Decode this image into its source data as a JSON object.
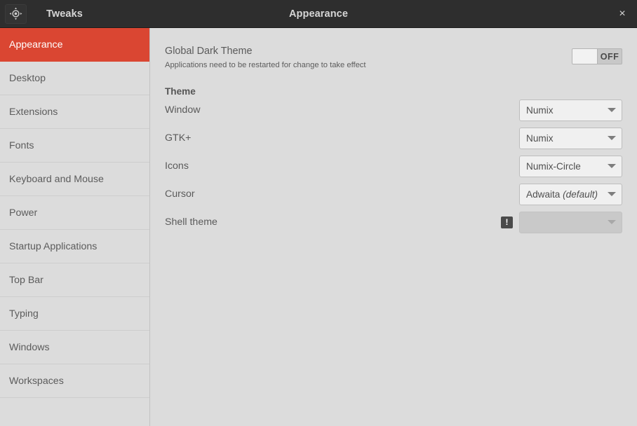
{
  "header": {
    "app_icon": "tweaks-target-icon",
    "app_name": "Tweaks",
    "title": "Appearance",
    "close_label": "×"
  },
  "sidebar": {
    "items": [
      {
        "label": "Appearance",
        "selected": true
      },
      {
        "label": "Desktop",
        "selected": false
      },
      {
        "label": "Extensions",
        "selected": false
      },
      {
        "label": "Fonts",
        "selected": false
      },
      {
        "label": "Keyboard and Mouse",
        "selected": false
      },
      {
        "label": "Power",
        "selected": false
      },
      {
        "label": "Startup Applications",
        "selected": false
      },
      {
        "label": "Top Bar",
        "selected": false
      },
      {
        "label": "Typing",
        "selected": false
      },
      {
        "label": "Windows",
        "selected": false
      },
      {
        "label": "Workspaces",
        "selected": false
      }
    ],
    "selected_color": "#da4632"
  },
  "main": {
    "global_dark_theme": {
      "title": "Global Dark Theme",
      "subtitle": "Applications need to be restarted for change to take effect",
      "switch_state": "OFF"
    },
    "theme_section": {
      "heading": "Theme",
      "rows": [
        {
          "label": "Window",
          "value": "Numix",
          "value_suffix": "",
          "disabled": false,
          "warning": false
        },
        {
          "label": "GTK+",
          "value": "Numix",
          "value_suffix": "",
          "disabled": false,
          "warning": false
        },
        {
          "label": "Icons",
          "value": "Numix-Circle",
          "value_suffix": "",
          "disabled": false,
          "warning": false
        },
        {
          "label": "Cursor",
          "value": "Adwaita",
          "value_suffix": "(default)",
          "disabled": false,
          "warning": false
        },
        {
          "label": "Shell theme",
          "value": "",
          "value_suffix": "",
          "disabled": true,
          "warning": true,
          "warning_glyph": "!"
        }
      ]
    }
  }
}
